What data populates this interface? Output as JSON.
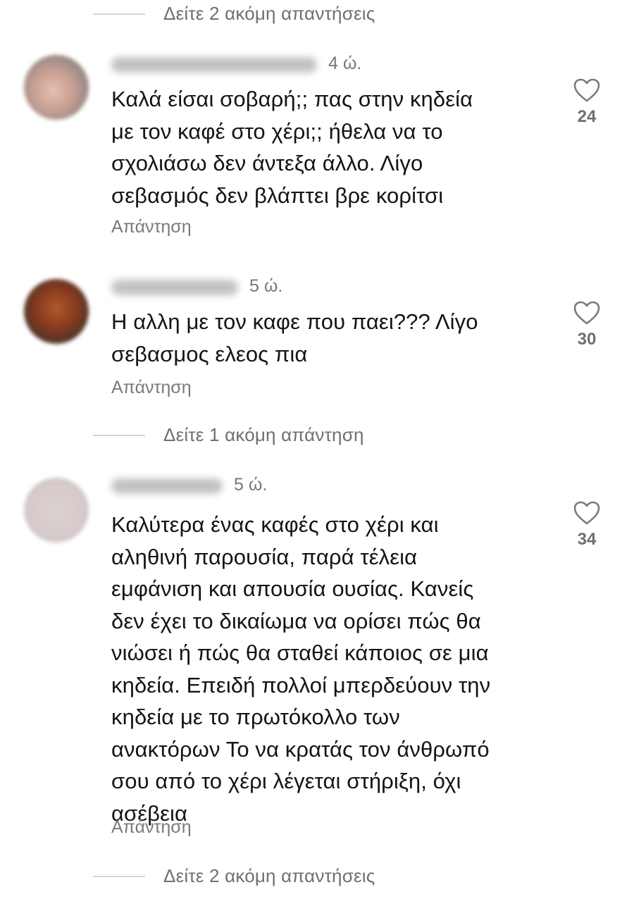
{
  "more_replies": [
    {
      "label": "Δείτε 2 ακόμη απαντήσεις"
    },
    {
      "label": "Δείτε 1 ακόμη απάντηση"
    },
    {
      "label": "Δείτε 2 ακόμη απαντήσεις"
    }
  ],
  "comments": [
    {
      "username": "[blurred]",
      "time": "4 ώ.",
      "lines": [
        "Καλά είσαι σοβαρή;; πας στην κηδεία",
        "με τον καφέ στο χέρι;; ήθελα να το",
        "σχολιάσω δεν άντεξα άλλο. Λίγο",
        "σεβασμός δεν βλάπτει βρε κορίτσι"
      ],
      "reply_label": "Απάντηση",
      "likes": "24",
      "like_icon": "heart-outline-icon"
    },
    {
      "username": "[blurred]",
      "time": "5 ώ.",
      "lines": [
        "Η αλλη με τον καφε που παει??? Λίγο",
        "σεβασμος ελεος πια"
      ],
      "reply_label": "Απάντηση",
      "likes": "30",
      "like_icon": "heart-outline-icon"
    },
    {
      "username": "[blurred]",
      "time": "5 ώ.",
      "lines": [
        "Καλύτερα ένας καφές στο χέρι και",
        "αληθινή παρουσία, παρά τέλεια",
        "εμφάνιση και απουσία ουσίας. Κανείς",
        "δεν έχει το δικαίωμα να ορίσει πώς θα",
        "νιώσει ή πώς θα σταθεί κάποιος σε μια",
        "κηδεία. Επειδή πολλοί μπερδεύουν την",
        "κηδεία με το πρωτόκολλο των",
        "ανακτόρων Το να κρατάς τον άνθρωπό",
        "σου από το χέρι λέγεται στήριξη, όχι",
        "ασέβεια"
      ],
      "reply_label": "Απάντηση",
      "likes": "34",
      "like_icon": "heart-outline-icon"
    }
  ],
  "colors": {
    "text_primary": "#141414",
    "text_secondary": "#777777",
    "divider": "#d6d6d6",
    "background": "#ffffff"
  }
}
